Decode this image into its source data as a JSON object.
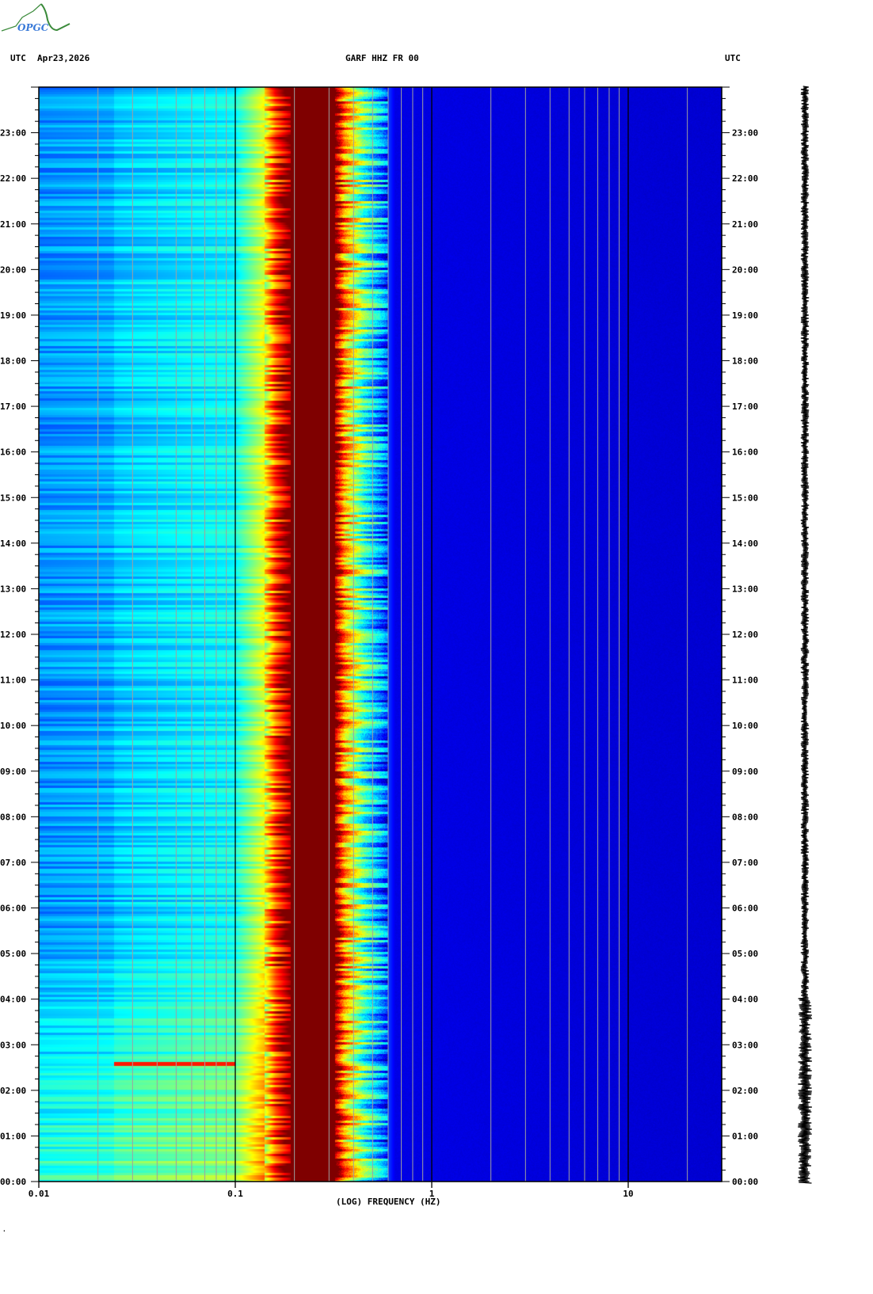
{
  "logo": {
    "text": "OPGC"
  },
  "header": {
    "left_tz": "UTC",
    "date": "Apr23,2026",
    "station": "GARF HHZ FR 00",
    "right_tz": "UTC"
  },
  "footer": {
    "mark": "·"
  },
  "chart_data": {
    "type": "heatmap",
    "title": "GARF HHZ FR 00",
    "xlabel": "(LOG) FREQUENCY (HZ)",
    "ylabel": "UTC",
    "x_scale": "log",
    "xlim": [
      0.01,
      30
    ],
    "x_ticks": [
      {
        "value": 0.01,
        "label": "0.01"
      },
      {
        "value": 0.1,
        "label": "0.1"
      },
      {
        "value": 1,
        "label": "1"
      },
      {
        "value": 10,
        "label": "10"
      }
    ],
    "ylim_hours": [
      0,
      24
    ],
    "y_ticks": [
      "00:00",
      "01:00",
      "02:00",
      "03:00",
      "04:00",
      "05:00",
      "06:00",
      "07:00",
      "08:00",
      "09:00",
      "10:00",
      "11:00",
      "12:00",
      "13:00",
      "14:00",
      "15:00",
      "16:00",
      "17:00",
      "18:00",
      "19:00",
      "20:00",
      "21:00",
      "22:00",
      "23:00"
    ],
    "colormap": "jet",
    "grid": true,
    "spectral_profile": {
      "freq_hz": [
        0.01,
        0.024,
        0.1,
        0.14,
        0.16,
        0.19,
        0.32,
        0.36,
        0.45,
        0.55,
        0.65,
        30
      ],
      "relative_power": [
        0.3,
        0.32,
        0.38,
        0.6,
        0.82,
        1.0,
        1.0,
        0.72,
        0.45,
        0.28,
        0.1,
        0.08
      ]
    },
    "events": [
      {
        "time_utc": "02:35",
        "freq_range_hz": [
          0.024,
          0.1
        ],
        "relative_power": 0.85
      }
    ]
  }
}
